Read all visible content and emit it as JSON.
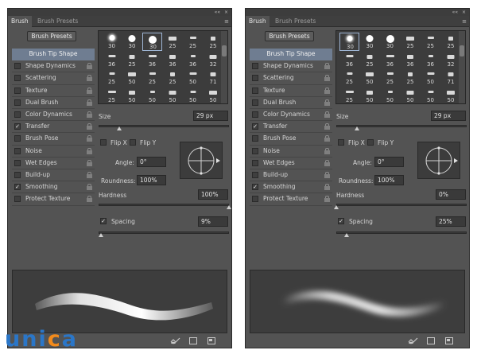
{
  "window_controls": {
    "collapse": "««",
    "close": "×"
  },
  "panels": [
    {
      "tabs": [
        "Brush",
        "Brush Presets"
      ],
      "tab_menu": "≡",
      "presets_button": "Brush Presets",
      "header_option": "Brush Tip Shape",
      "options": [
        {
          "label": "Shape Dynamics",
          "checked": false
        },
        {
          "label": "Scattering",
          "checked": false
        },
        {
          "label": "Texture",
          "checked": false
        },
        {
          "label": "Dual Brush",
          "checked": false
        },
        {
          "label": "Color Dynamics",
          "checked": false
        },
        {
          "label": "Transfer",
          "checked": true
        },
        {
          "label": "Brush Pose",
          "checked": false
        },
        {
          "label": "Noise",
          "checked": false
        },
        {
          "label": "Wet Edges",
          "checked": false
        },
        {
          "label": "Build-up",
          "checked": false
        },
        {
          "label": "Smoothing",
          "checked": true
        },
        {
          "label": "Protect Texture",
          "checked": false
        }
      ],
      "tip_sizes": [
        "30",
        "30",
        "30",
        "25",
        "25",
        "25",
        "36",
        "25",
        "36",
        "36",
        "36",
        "32",
        "25",
        "50",
        "25",
        "25",
        "50",
        "71",
        "25",
        "50",
        "50",
        "50",
        "50",
        "50"
      ],
      "selected_tip": 2,
      "size_label": "Size",
      "size_value": "29 px",
      "flip_x": "Flip X",
      "flip_y": "Flip Y",
      "angle_label": "Angle:",
      "angle_value": "0°",
      "roundness_label": "Roundness:",
      "roundness_value": "100%",
      "hardness_label": "Hardness",
      "hardness_value": "100%",
      "spacing_label": "Spacing",
      "spacing_value": "9%",
      "spacing_checked": true,
      "size_slider": 0.16,
      "hardness_slider": 1.0,
      "spacing_slider": 0.02
    },
    {
      "tabs": [
        "Brush",
        "Brush Presets"
      ],
      "tab_menu": "≡",
      "presets_button": "Brush Presets",
      "header_option": "Brush Tip Shape",
      "options": [
        {
          "label": "Shape Dynamics",
          "checked": false
        },
        {
          "label": "Scattering",
          "checked": false
        },
        {
          "label": "Texture",
          "checked": false
        },
        {
          "label": "Dual Brush",
          "checked": false
        },
        {
          "label": "Color Dynamics",
          "checked": false
        },
        {
          "label": "Transfer",
          "checked": true
        },
        {
          "label": "Brush Pose",
          "checked": false
        },
        {
          "label": "Noise",
          "checked": false
        },
        {
          "label": "Wet Edges",
          "checked": false
        },
        {
          "label": "Build-up",
          "checked": false
        },
        {
          "label": "Smoothing",
          "checked": true
        },
        {
          "label": "Protect Texture",
          "checked": false
        }
      ],
      "tip_sizes": [
        "30",
        "30",
        "30",
        "25",
        "25",
        "25",
        "36",
        "25",
        "36",
        "36",
        "36",
        "32",
        "25",
        "50",
        "25",
        "25",
        "50",
        "71",
        "25",
        "50",
        "50",
        "50",
        "50",
        "50"
      ],
      "selected_tip": 0,
      "size_label": "Size",
      "size_value": "29 px",
      "flip_x": "Flip X",
      "flip_y": "Flip Y",
      "angle_label": "Angle:",
      "angle_value": "0°",
      "roundness_label": "Roundness:",
      "roundness_value": "100%",
      "hardness_label": "Hardness",
      "hardness_value": "0%",
      "spacing_label": "Spacing",
      "spacing_value": "25%",
      "spacing_checked": true,
      "size_slider": 0.16,
      "hardness_slider": 0.0,
      "spacing_slider": 0.08
    }
  ],
  "logo": {
    "letters": [
      "u",
      "n",
      "i",
      "c",
      "a"
    ]
  },
  "colors": {
    "panel": "#535353",
    "header_highlight": "#6f7d91",
    "logo_blue": "#2a76c8",
    "logo_orange": "#f28a1b"
  }
}
